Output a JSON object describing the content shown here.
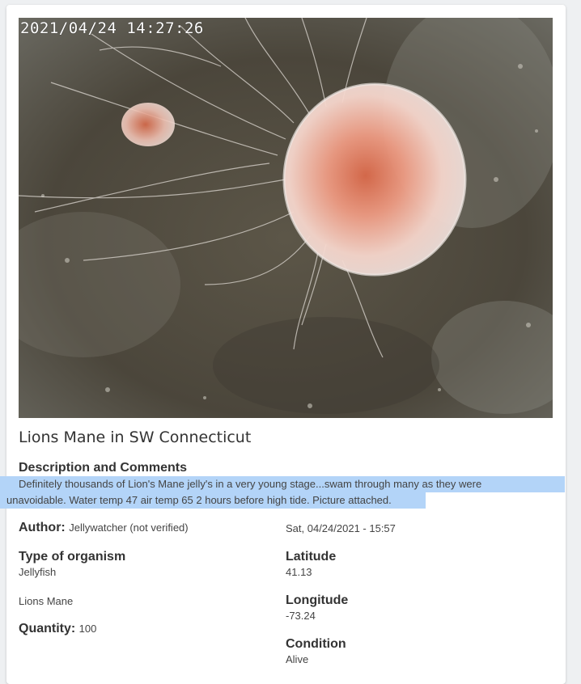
{
  "photo": {
    "timestamp": "2021/04/24 14:27:26",
    "subject": "lions-mane-jellyfish-photo"
  },
  "observation": {
    "title": "Lions Mane in SW Connecticut",
    "description_heading": "Description and Comments",
    "description_line1": "Definitely thousands of Lion's Mane jelly's in a very young stage...swam through many as they were",
    "description_line2": "unavoidable. Water temp 47 air temp 65 2 hours before high tide. Picture attached.",
    "author_label": "Author:",
    "author_value": "Jellywatcher (not verified)",
    "date": "Sat, 04/24/2021 - 15:57",
    "organism_label": "Type of organism",
    "organism_value": "Jellyfish",
    "species": "Lions Mane",
    "quantity_label": "Quantity:",
    "quantity_value": "100",
    "latitude_label": "Latitude",
    "latitude_value": "41.13",
    "longitude_label": "Longitude",
    "longitude_value": "-73.24",
    "condition_label": "Condition",
    "condition_value": "Alive"
  },
  "colors": {
    "highlight": "#b3d4f8",
    "card": "#ffffff",
    "page": "#eef0f2"
  }
}
